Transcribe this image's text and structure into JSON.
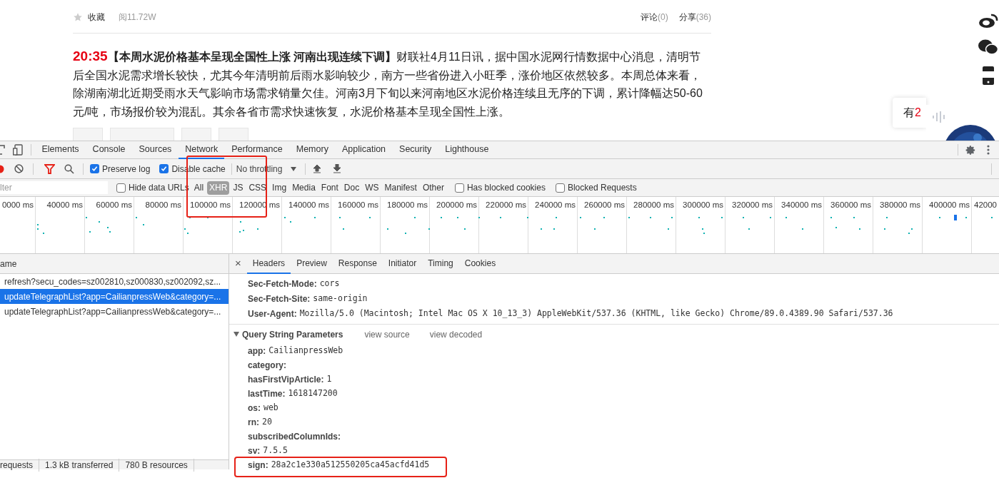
{
  "article": {
    "favorite": "收藏",
    "reads": "阅11.72W",
    "comments": {
      "label": "评论",
      "count": "(0)"
    },
    "shares": {
      "label": "分享",
      "count": "(36)"
    },
    "time": "20:35",
    "headline": "【本周水泥价格基本呈现全国性上涨 河南出现连续下调】",
    "body": "财联社4月11日讯，据中国水泥网行情数据中心消息，清明节后全国水泥需求增长较快，尤其今年清明前后雨水影响较少，南方一些省份进入小旺季，涨价地区依然较多。本周总体来看，除湖南湖北近期受雨水天气影响市场需求销量欠佳。河南3月下旬以来河南地区水泥价格连续且无序的下调，累计降幅达50-60元/吨，市场报价较为混乱。其余各省市需求快速恢复，水泥价格基本呈现全国性上涨。"
  },
  "notice": {
    "prefix": "有",
    "count": "2"
  },
  "devtools": {
    "tabs": [
      {
        "label": "Elements",
        "selected": false
      },
      {
        "label": "Console",
        "selected": false
      },
      {
        "label": "Sources",
        "selected": false
      },
      {
        "label": "Network",
        "selected": true
      },
      {
        "label": "Performance",
        "selected": false
      },
      {
        "label": "Memory",
        "selected": false
      },
      {
        "label": "Application",
        "selected": false
      },
      {
        "label": "Security",
        "selected": false
      },
      {
        "label": "Lighthouse",
        "selected": false
      }
    ],
    "toolbar": {
      "preserve_log": {
        "label": "Preserve log",
        "checked": true
      },
      "disable_cache": {
        "label": "Disable cache",
        "checked": true
      },
      "throttling": "No throttling"
    },
    "filter": {
      "placeholder": "lter",
      "hide_data_urls": {
        "label": "Hide data URLs",
        "checked": false
      },
      "types": [
        {
          "label": "All",
          "selected": false
        },
        {
          "label": "XHR",
          "selected": true
        },
        {
          "label": "JS",
          "selected": false
        },
        {
          "label": "CSS",
          "selected": false
        },
        {
          "label": "Img",
          "selected": false
        },
        {
          "label": "Media",
          "selected": false
        },
        {
          "label": "Font",
          "selected": false
        },
        {
          "label": "Doc",
          "selected": false
        },
        {
          "label": "WS",
          "selected": false
        },
        {
          "label": "Manifest",
          "selected": false
        },
        {
          "label": "Other",
          "selected": false
        }
      ],
      "has_blocked_cookies": {
        "label": "Has blocked cookies",
        "checked": false
      },
      "blocked_requests": {
        "label": "Blocked Requests",
        "checked": false
      }
    },
    "timeline_labels": [
      "0000 ms",
      "40000 ms",
      "60000 ms",
      "80000 ms",
      "100000 ms",
      "120000 ms",
      "140000 ms",
      "160000 ms",
      "180000 ms",
      "200000 ms",
      "220000 ms",
      "240000 ms",
      "260000 ms",
      "280000 ms",
      "300000 ms",
      "320000 ms",
      "340000 ms",
      "360000 ms",
      "380000 ms",
      "400000 ms",
      "42000"
    ],
    "requests": {
      "column": "ame",
      "rows": [
        {
          "name": "refresh?secu_codes=sz002810,sz000830,sz002092,sz...",
          "selected": false
        },
        {
          "name": "updateTelegraphList?app=CailianpressWeb&category=...",
          "selected": true
        },
        {
          "name": "updateTelegraphList?app=CailianpressWeb&category=...",
          "selected": false
        }
      ]
    },
    "status": [
      "requests",
      "1.3 kB transferred",
      "780 B resources"
    ],
    "detail_tabs": [
      {
        "label": "Headers",
        "selected": true
      },
      {
        "label": "Preview",
        "selected": false
      },
      {
        "label": "Response",
        "selected": false
      },
      {
        "label": "Initiator",
        "selected": false
      },
      {
        "label": "Timing",
        "selected": false
      },
      {
        "label": "Cookies",
        "selected": false
      }
    ],
    "close": "×",
    "headers": [
      {
        "key": "Sec-Fetch-Mode:",
        "value": "cors"
      },
      {
        "key": "Sec-Fetch-Site:",
        "value": "same-origin"
      },
      {
        "key": "User-Agent:",
        "value": "Mozilla/5.0 (Macintosh; Intel Mac OS X 10_13_3) AppleWebKit/537.36 (KHTML, like Gecko) Chrome/89.0.4389.90 Safari/537.36"
      }
    ],
    "query": {
      "title": "Query String Parameters",
      "expanded": true,
      "view_source": "view source",
      "view_decoded": "view decoded",
      "params": [
        {
          "key": "app:",
          "value": "CailianpressWeb"
        },
        {
          "key": "category:"
        },
        {
          "key": "hasFirstVipArticle:",
          "value": "1"
        },
        {
          "key": "lastTime:",
          "value": "1618147200"
        },
        {
          "key": "os:",
          "value": "web"
        },
        {
          "key": "rn:",
          "value": "20"
        },
        {
          "key": "subscribedColumnIds:"
        },
        {
          "key": "sv:",
          "value": "7.5.5"
        },
        {
          "key": "sign:",
          "value": "28a2c1e330a512550205ca45acfd41d5"
        }
      ]
    }
  }
}
